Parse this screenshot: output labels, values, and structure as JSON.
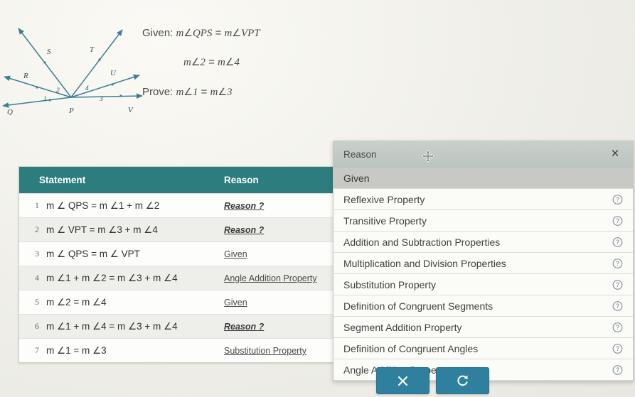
{
  "diagram": {
    "vertex_label": "P",
    "ray_labels": [
      "Q",
      "R",
      "S",
      "T",
      "U",
      "V"
    ],
    "angle_numbers": [
      "1",
      "2",
      "3",
      "4"
    ],
    "stroke_color": "#3b7f93"
  },
  "given_prove": {
    "given_label": "Given:",
    "given_line1": {
      "m1": "m",
      "ang1": "∠",
      "arg1": "QPS",
      "eq": "=",
      "m2": "m",
      "ang2": "∠",
      "arg2": "VPT"
    },
    "given_line2": {
      "m1": "m",
      "ang1": "∠",
      "arg1": "2",
      "eq": "=",
      "m2": "m",
      "ang2": "∠",
      "arg2": "4"
    },
    "prove_label": "Prove:",
    "prove_line": {
      "m1": "m",
      "ang1": "∠",
      "arg1": "1",
      "eq": "=",
      "m2": "m",
      "ang2": "∠",
      "arg2": "3"
    }
  },
  "proof_table": {
    "headers": {
      "statement": "Statement",
      "reason": "Reason"
    },
    "header_color": "#2d7d7e",
    "rows": [
      {
        "num": "1",
        "statement": "m ∠ QPS  =  m ∠1 + m ∠2",
        "reason": "Reason ?",
        "blank": true
      },
      {
        "num": "2",
        "statement": "m ∠ VPT  =  m ∠3 + m ∠4",
        "reason": "Reason ?",
        "blank": true
      },
      {
        "num": "3",
        "statement": "m ∠ QPS  =  m ∠ VPT",
        "reason": "Given",
        "blank": false
      },
      {
        "num": "4",
        "statement": "m ∠1 + m ∠2  =  m ∠3 + m ∠4",
        "reason": "Angle Addition Property",
        "blank": false
      },
      {
        "num": "5",
        "statement": "m ∠2  =  m ∠4",
        "reason": "Given",
        "blank": false
      },
      {
        "num": "6",
        "statement": "m ∠1 + m ∠4  =  m ∠3 + m ∠4",
        "reason": "Reason ?",
        "blank": true
      },
      {
        "num": "7",
        "statement": "m ∠1  =  m ∠3",
        "reason": "Substitution Property",
        "blank": false
      }
    ]
  },
  "reason_panel": {
    "title": "Reason",
    "close_label": "×",
    "move_cursor_icon": "move-cursor-icon",
    "options": [
      {
        "label": "Given",
        "selected": true,
        "has_help": false
      },
      {
        "label": "Reflexive Property",
        "selected": false,
        "has_help": true
      },
      {
        "label": "Transitive Property",
        "selected": false,
        "has_help": true
      },
      {
        "label": "Addition and Subtraction Properties",
        "selected": false,
        "has_help": true
      },
      {
        "label": "Multiplication and Division Properties",
        "selected": false,
        "has_help": true
      },
      {
        "label": "Substitution Property",
        "selected": false,
        "has_help": true
      },
      {
        "label": "Definition of Congruent Segments",
        "selected": false,
        "has_help": true
      },
      {
        "label": "Segment Addition Property",
        "selected": false,
        "has_help": true
      },
      {
        "label": "Definition of Congruent Angles",
        "selected": false,
        "has_help": true
      },
      {
        "label": "Angle Addition Property",
        "selected": false,
        "has_help": true
      }
    ]
  },
  "action_bar": {
    "cancel_icon": "close-x-icon",
    "reset_icon": "refresh-undo-icon",
    "button_color": "#2f7f9e"
  }
}
